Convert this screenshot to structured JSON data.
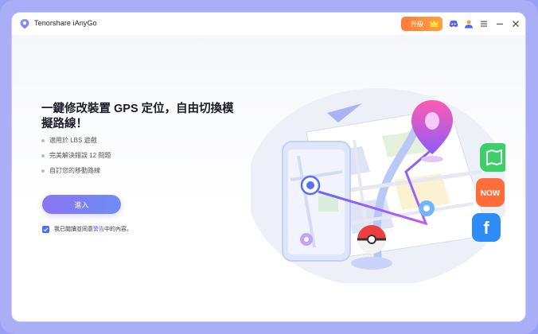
{
  "app": {
    "title": "Tenorshare iAnyGo",
    "upgrade_label": "升級"
  },
  "titlebar": {
    "icons": [
      "discord-icon",
      "user-icon",
      "menu-icon",
      "minimize-icon",
      "close-icon"
    ]
  },
  "main": {
    "headline": "一鍵修改裝置 GPS 定位，自由切換模擬路線！",
    "features": [
      "適用於 LBS 遊戲",
      "完美解決錯誤 12 問題",
      "自訂您的移動路線"
    ],
    "enter_label": "進入",
    "agree_prefix": "我已閱讀並同意",
    "agree_link": "警告",
    "agree_suffix": "中的內容。",
    "agree_checked": true
  },
  "illustration": {
    "app_icons": [
      "map-app-icon",
      "now-app-icon",
      "f-app-icon"
    ],
    "now_label": "NOW",
    "f_label": "f"
  },
  "colors": {
    "accent": "#4b6cf7",
    "upgrade": "#ff8a3a",
    "frame": "#a9aef7"
  }
}
